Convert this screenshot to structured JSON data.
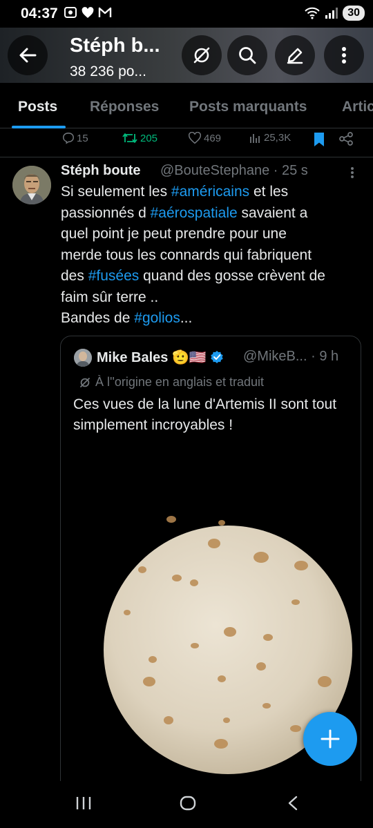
{
  "status_bar": {
    "time": "04:37",
    "left_icons": [
      "screenshot-icon",
      "heart-icon",
      "gmail-icon"
    ],
    "right_icons": [
      "wifi-icon",
      "signal-icon"
    ],
    "battery": "30"
  },
  "header": {
    "title": "Stéph b...",
    "subtitle": "38 236 po..."
  },
  "tabs": [
    {
      "label": "Posts",
      "active": true
    },
    {
      "label": "Réponses",
      "active": false
    },
    {
      "label": "Posts marquants",
      "active": false
    },
    {
      "label": "Artic",
      "active": false
    }
  ],
  "prev_actions": {
    "replies": "15",
    "reposts": "205",
    "likes": "469",
    "views": "25,3K"
  },
  "post": {
    "author_name": "Stéph boute",
    "author_handle": "@BouteStephane",
    "time_separator": "·",
    "time": "25 s",
    "text_lines": [
      [
        {
          "t": "Si seulement les "
        },
        {
          "t": "#américains",
          "h": true
        },
        {
          "t": " et les"
        }
      ],
      [
        {
          "t": "passionnés d "
        },
        {
          "t": "#aérospatiale",
          "h": true
        },
        {
          "t": " savaient a"
        }
      ],
      [
        {
          "t": "quel point je peut prendre pour une"
        }
      ],
      [
        {
          "t": "merde tous les connards qui fabriquent"
        }
      ],
      [
        {
          "t": "des "
        },
        {
          "t": "#fusées",
          "h": true
        },
        {
          "t": " quand des gosse crèvent de"
        }
      ],
      [
        {
          "t": "faim sûr terre .."
        }
      ],
      [
        {
          "t": "Bandes de "
        },
        {
          "t": "#golios",
          "h": true
        },
        {
          "t": "..."
        }
      ]
    ]
  },
  "quote": {
    "author_name": "Mike Bales",
    "emoji": "🫡🇺🇸",
    "handle": "@MikeB...",
    "time_separator": "·",
    "time": "9 h",
    "translation_note": "À l''origine en anglais et traduit",
    "text": "Ces vues de la lune d'Artemis II sont tout simplement incroyables !"
  },
  "colors": {
    "accent": "#1d9bf0",
    "repost": "#00ba7c",
    "muted": "#71767b",
    "text": "#e7e9ea",
    "background": "#000000"
  },
  "fab_icon": "plus-icon",
  "nav": [
    "recents-icon",
    "home-icon",
    "back-icon"
  ]
}
